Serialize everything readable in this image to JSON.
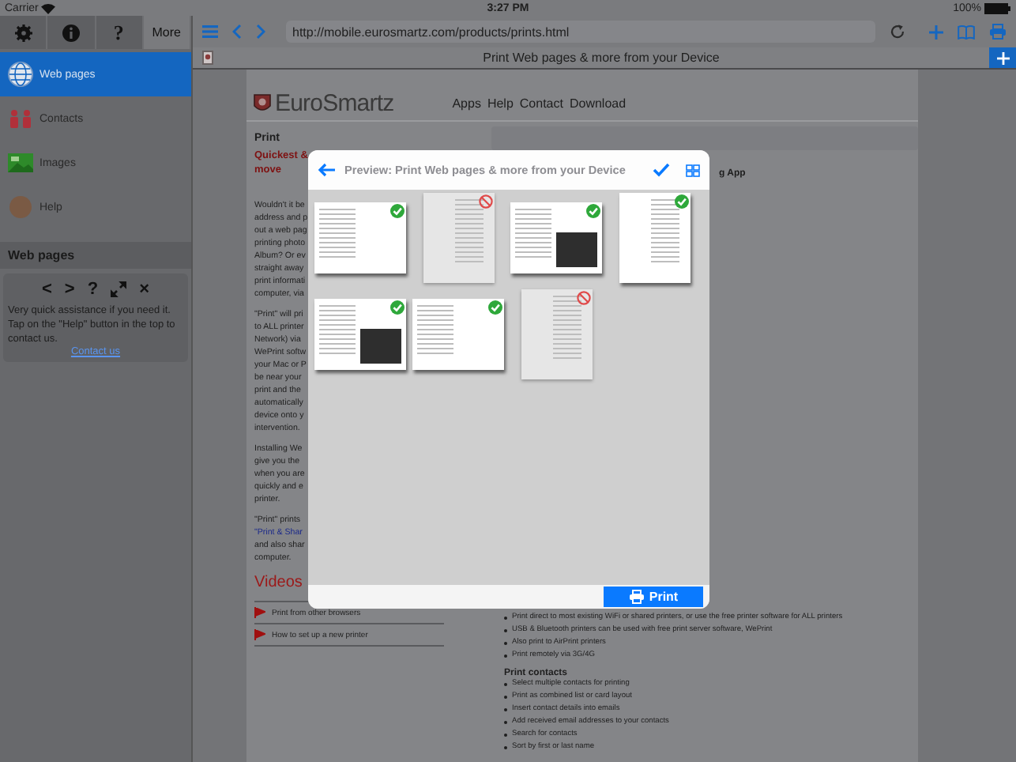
{
  "status_bar": {
    "carrier": "Carrier",
    "time": "3:27 PM",
    "battery": "100%"
  },
  "sidebar": {
    "toolbar": [
      {
        "kind": "gear",
        "selected": false
      },
      {
        "kind": "info",
        "selected": false
      },
      {
        "kind": "text",
        "label": "?",
        "selected": false
      },
      {
        "kind": "text",
        "label": "More",
        "selected": true
      }
    ],
    "items": [
      {
        "kind": "globe",
        "label": "Web pages",
        "selected": true
      },
      {
        "kind": "people",
        "label": "Contacts",
        "selected": false
      },
      {
        "kind": "image",
        "label": "Images",
        "selected": false
      },
      {
        "kind": "avatar",
        "label": "Help",
        "selected": false
      }
    ],
    "section_title": "Web pages",
    "help_card": {
      "nav": [
        {
          "kind": "text",
          "label": "<"
        },
        {
          "kind": "text",
          "label": ">"
        },
        {
          "kind": "text",
          "label": "?"
        },
        {
          "kind": "expand"
        },
        {
          "kind": "text",
          "label": "×"
        }
      ],
      "text": "Very quick assistance if you need it. Tap on the \"Help\" button in the top to contact us.",
      "link": "Contact us"
    }
  },
  "browser": {
    "url": "http://mobile.eurosmartz.com/products/prints.html",
    "tab_title": "Print Web pages & more from your Device"
  },
  "page": {
    "logo": "EuroSmartz",
    "nav": [
      "Apps",
      "Help",
      "Contact",
      "Download"
    ],
    "heading": "Print",
    "subheading": [
      "Quickest &",
      "move"
    ],
    "paragraphs": [
      [
        "Wouldn't it be",
        "address and p",
        "out a web pag",
        "printing photo",
        "Album? Or ev",
        "straight away",
        "print informati",
        "computer, via"
      ],
      [
        "\"Print\" will pri",
        "to ALL printer",
        "Network) via",
        "WePrint softw",
        "your Mac or P",
        "be near your",
        "print and the",
        "automatically",
        "device onto y",
        "intervention."
      ],
      [
        "Installing We",
        "give you the",
        "when you are",
        "quickly and e",
        "printer."
      ],
      [
        "\"Print\" prints",
        {
          "kind": "link",
          "text": "\"Print & Shar"
        },
        "and also shar",
        "computer."
      ]
    ],
    "videos_title": "Videos",
    "videos": [
      "Print from other browsers",
      "How to set up a new printer"
    ],
    "right_fragment": "g App",
    "features": [
      "Print direct to most existing WiFi or shared printers, or use the free printer software for ALL printers",
      "USB & Bluetooth printers can be used with free print server software, WePrint",
      "Also print to AirPrint printers",
      "Print remotely via 3G/4G"
    ],
    "contacts_title": "Print contacts",
    "contacts": [
      "Select multiple contacts for printing",
      "Print as combined list or card layout",
      "Insert contact details into emails",
      "Add received email addresses to your contacts",
      "Search for contacts",
      "Sort by first or last name"
    ]
  },
  "preview": {
    "title": "Preview: Print Web pages & more from your Device",
    "pages": [
      {
        "kind": "landscape",
        "photo": false,
        "selected": true
      },
      {
        "kind": "portrait",
        "photo": false,
        "selected": false
      },
      {
        "kind": "landscape",
        "photo": true,
        "selected": true
      },
      {
        "kind": "portrait",
        "photo": false,
        "selected": true
      },
      {
        "kind": "landscape",
        "photo": true,
        "selected": true
      },
      {
        "kind": "landscape",
        "photo": false,
        "selected": true
      },
      {
        "kind": "portrait",
        "photo": false,
        "selected": false
      }
    ],
    "print_button": "Print"
  }
}
